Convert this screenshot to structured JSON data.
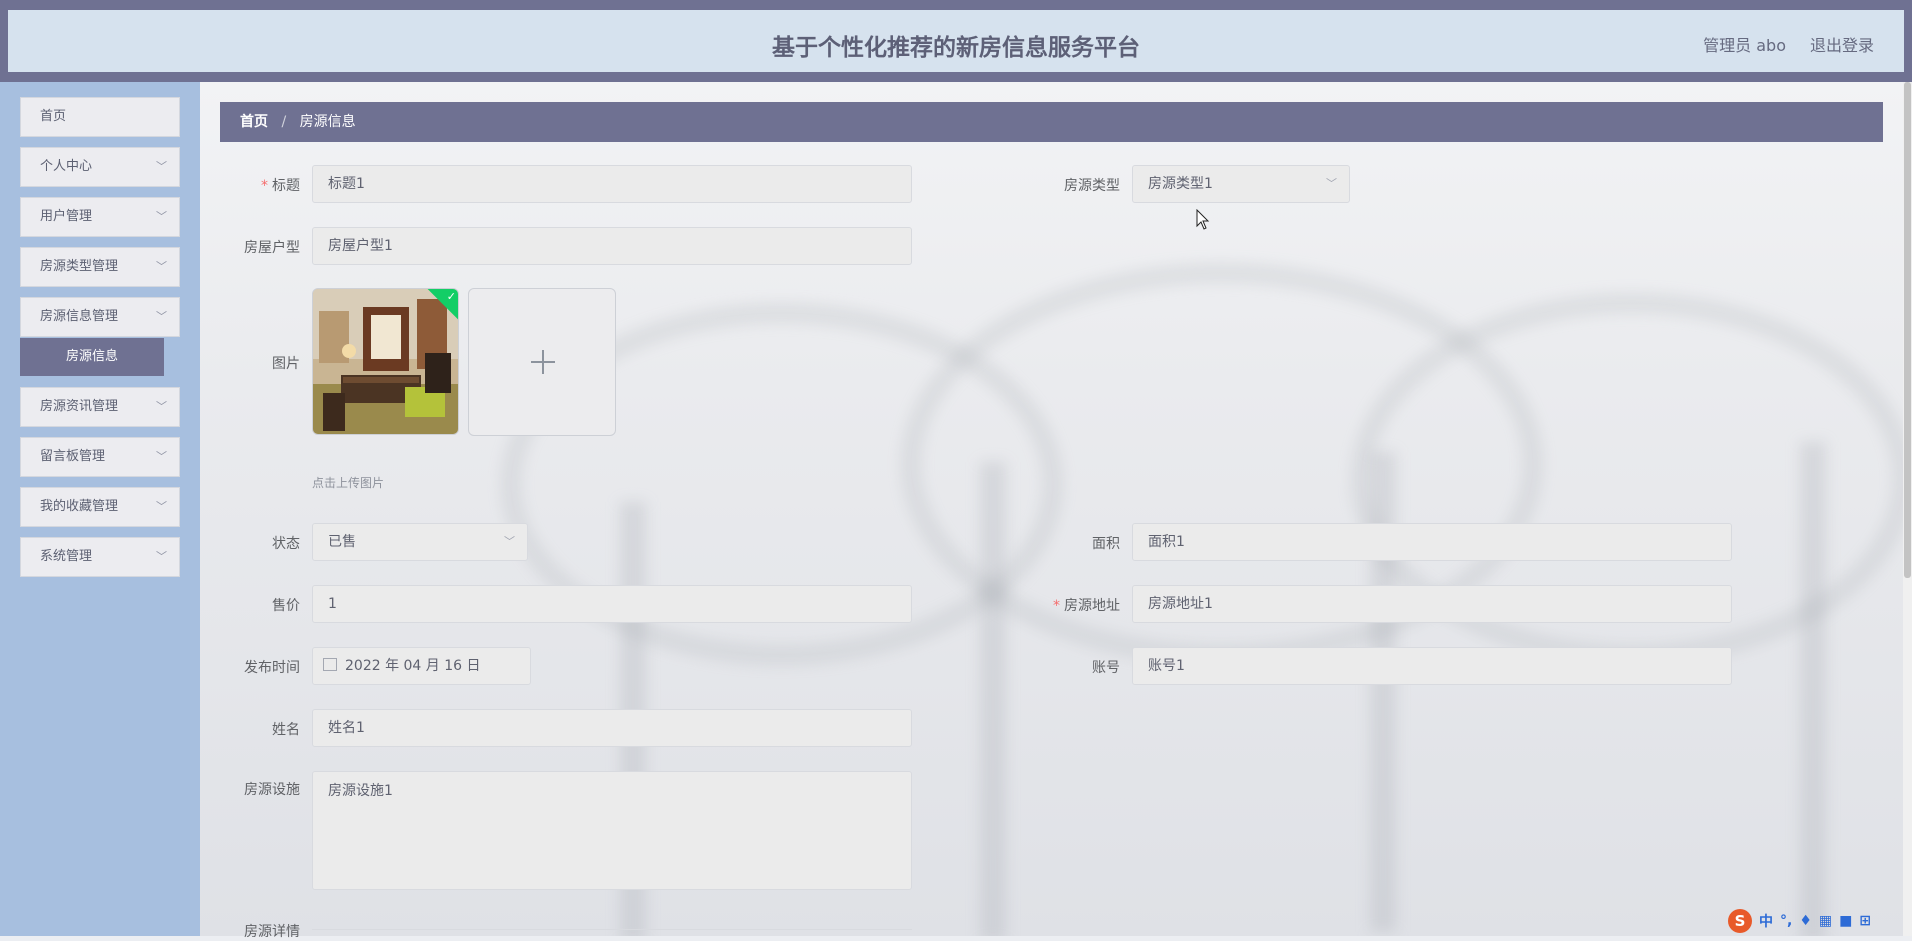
{
  "header": {
    "title": "基于个性化推荐的新房信息服务平台",
    "admin_label": "管理员 abo",
    "logout_label": "退出登录"
  },
  "sidebar": {
    "items": [
      {
        "label": "首页",
        "has_arrow": false
      },
      {
        "label": "个人中心",
        "has_arrow": true
      },
      {
        "label": "用户管理",
        "has_arrow": true
      },
      {
        "label": "房源类型管理",
        "has_arrow": true
      },
      {
        "label": "房源信息管理",
        "has_arrow": true
      },
      {
        "label": "房源资讯管理",
        "has_arrow": true
      },
      {
        "label": "留言板管理",
        "has_arrow": true
      },
      {
        "label": "我的收藏管理",
        "has_arrow": true
      },
      {
        "label": "系统管理",
        "has_arrow": true
      }
    ],
    "active_sub": "房源信息"
  },
  "breadcrumb": {
    "home": "首页",
    "separator": "/",
    "current": "房源信息"
  },
  "form": {
    "title_label": "标题",
    "title_value": "标题1",
    "type_label": "房源类型",
    "type_value": "房源类型1",
    "layout_label": "房屋户型",
    "layout_value": "房屋户型1",
    "image_label": "图片",
    "upload_hint": "点击上传图片",
    "status_label": "状态",
    "status_value": "已售",
    "area_label": "面积",
    "area_value": "面积1",
    "price_label": "售价",
    "price_value": "1",
    "address_label": "房源地址",
    "address_value": "房源地址1",
    "date_label": "发布时间",
    "date_value": "2022 年 04 月 16 日",
    "account_label": "账号",
    "account_value": "账号1",
    "name_label": "姓名",
    "name_value": "姓名1",
    "facility_label": "房源设施",
    "facility_value": "房源设施1",
    "detail_label": "房源详情"
  },
  "ime": {
    "lang": "中"
  },
  "colors": {
    "accent": "#6f7192",
    "sidebar_bg": "#a7bfdf",
    "header_bg": "#d6e2ee",
    "success": "#13ce66"
  }
}
